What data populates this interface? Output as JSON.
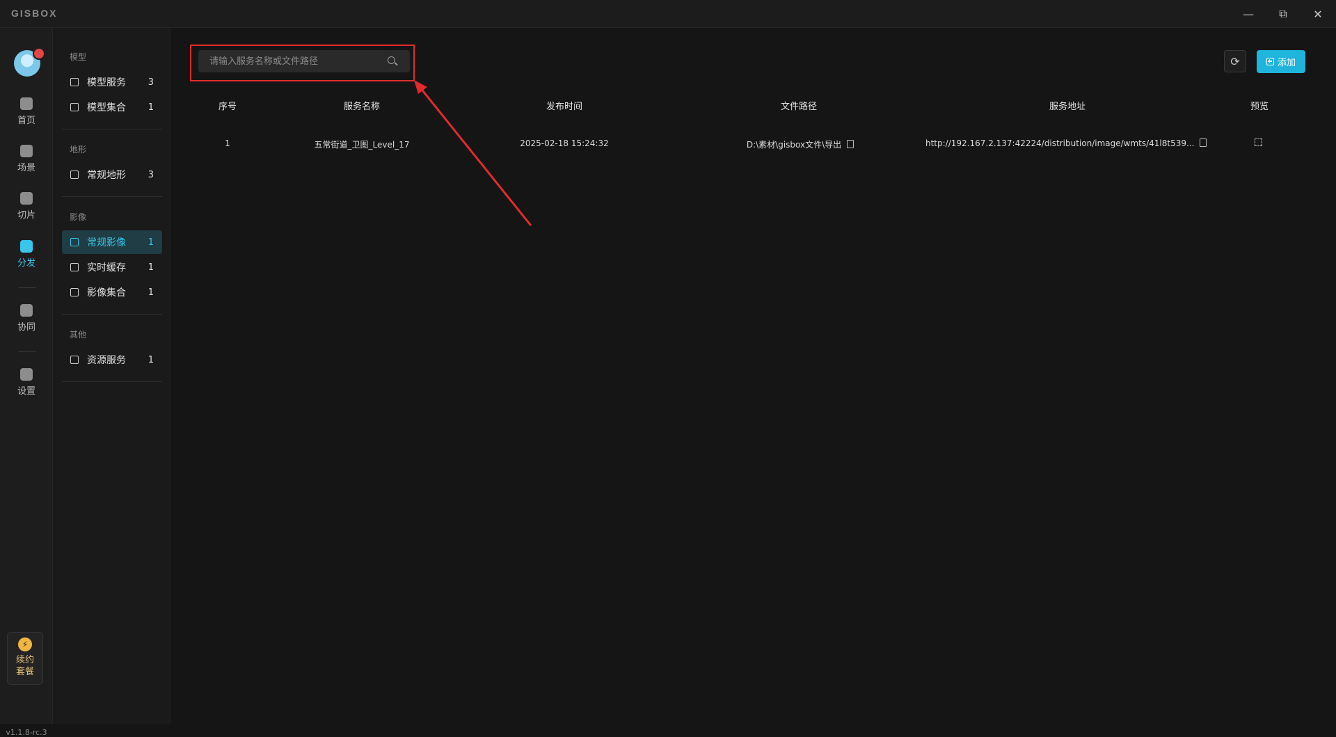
{
  "window": {
    "logo": "GISBOX",
    "controls": {
      "minimize": "—",
      "restore": "⧉",
      "close": "✕"
    }
  },
  "rail": {
    "items": [
      {
        "label": "首页",
        "icon": "home-icon",
        "active": false
      },
      {
        "label": "场景",
        "icon": "scene-icon",
        "active": false
      },
      {
        "label": "切片",
        "icon": "slice-icon",
        "active": false
      },
      {
        "label": "分发",
        "icon": "distribute-icon",
        "active": true
      },
      {
        "label": "协同",
        "icon": "collaborate-icon",
        "active": false
      },
      {
        "label": "设置",
        "icon": "settings-icon",
        "active": false
      }
    ],
    "plan": {
      "line1": "续约",
      "line2": "套餐"
    },
    "version": "v1.1.8-rc.3"
  },
  "sidebar": {
    "groups": [
      {
        "label": "模型",
        "items": [
          {
            "label": "模型服务",
            "count": "3"
          },
          {
            "label": "模型集合",
            "count": "1"
          }
        ]
      },
      {
        "label": "地形",
        "items": [
          {
            "label": "常规地形",
            "count": "3"
          }
        ]
      },
      {
        "label": "影像",
        "items": [
          {
            "label": "常规影像",
            "count": "1",
            "active": true
          },
          {
            "label": "实时缓存",
            "count": "1"
          },
          {
            "label": "影像集合",
            "count": "1"
          }
        ]
      },
      {
        "label": "其他",
        "items": [
          {
            "label": "资源服务",
            "count": "1"
          }
        ]
      }
    ]
  },
  "toolbar": {
    "search_placeholder": "请输入服务名称或文件路径",
    "refresh_icon": "⟳",
    "add_label": "添加"
  },
  "table": {
    "columns": [
      "序号",
      "服务名称",
      "发布时间",
      "文件路径",
      "服务地址",
      "预览"
    ],
    "rows": [
      {
        "index": "1",
        "name": "五常街道_卫图_Level_17",
        "time": "2025-02-18 15:24:32",
        "path": "D:\\素材\\gisbox文件\\导出",
        "url": "http://192.167.2.137:42224/distribution/image/wmts/41l8t539..."
      }
    ]
  },
  "annotation": {
    "color": "#e32b2b"
  }
}
